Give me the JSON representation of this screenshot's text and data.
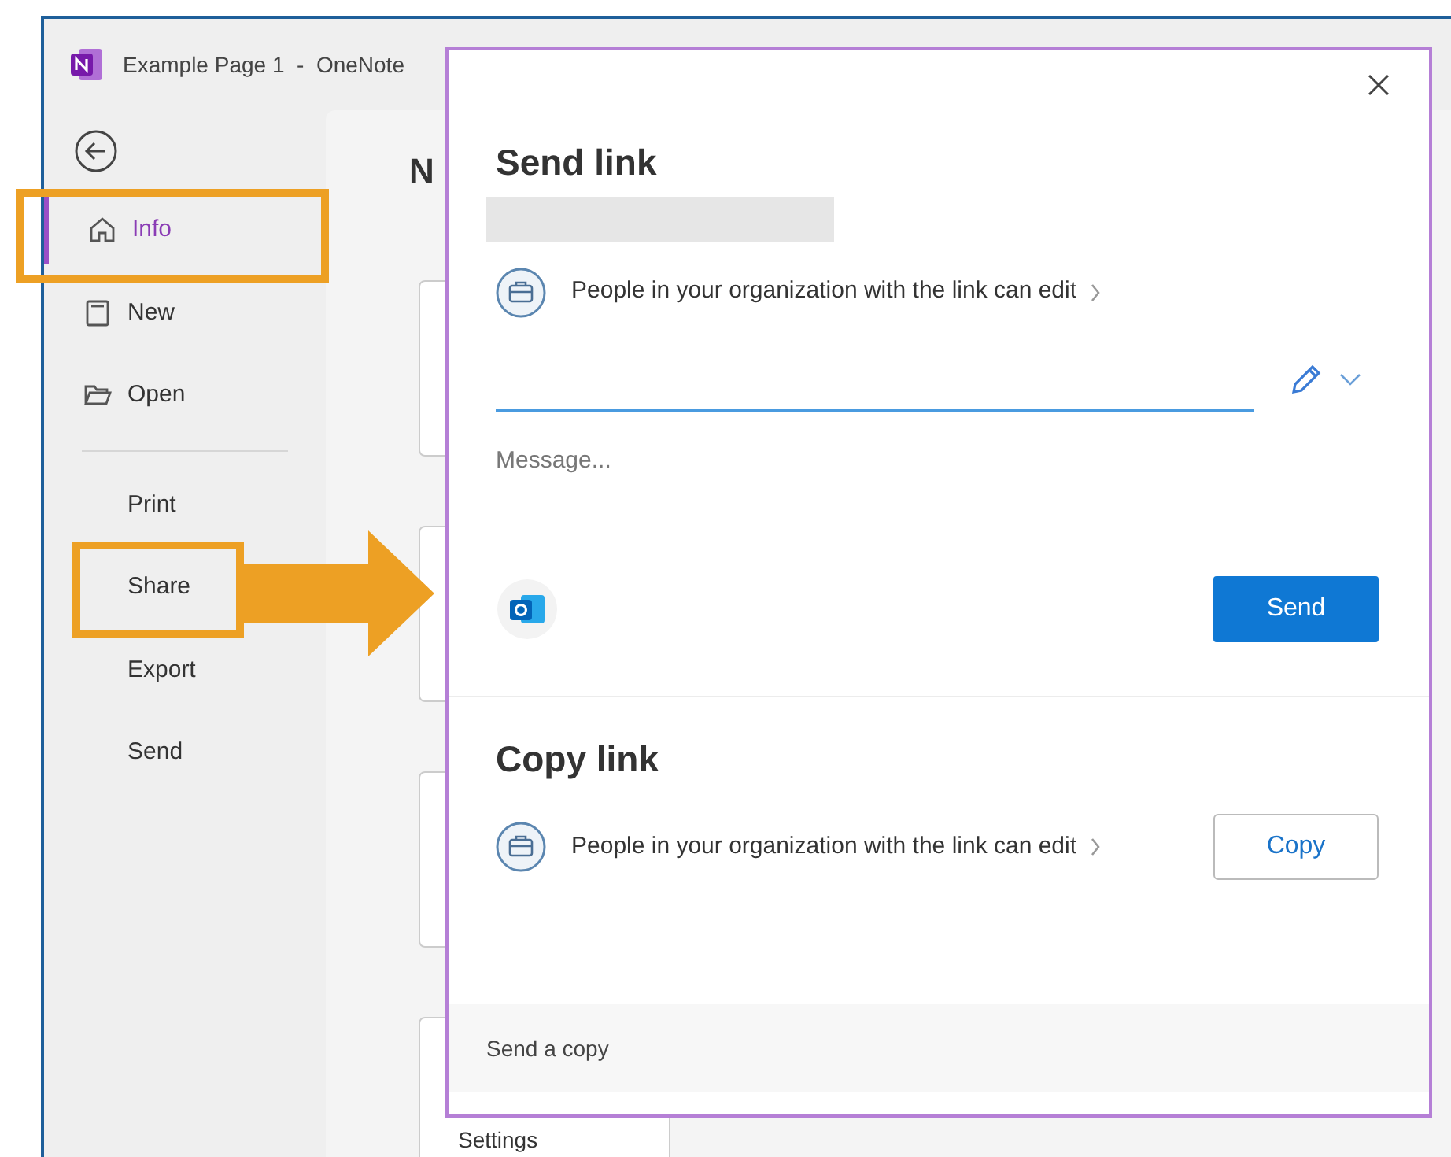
{
  "window": {
    "title": "Example Page 1  -  OneNote"
  },
  "sidebar": {
    "groups": [
      [
        {
          "label": "Info",
          "kind": "home",
          "selected": true,
          "highlighted": true,
          "arrow": false
        },
        {
          "label": "New",
          "kind": "page",
          "selected": false,
          "highlighted": false,
          "arrow": false
        },
        {
          "label": "Open",
          "kind": "folder",
          "selected": false,
          "highlighted": false,
          "arrow": false
        }
      ],
      [
        {
          "label": "Print",
          "kind": "plain",
          "selected": false,
          "highlighted": false,
          "arrow": false
        },
        {
          "label": "Share",
          "kind": "plain",
          "selected": false,
          "highlighted": true,
          "arrow": true
        },
        {
          "label": "Export",
          "kind": "plain",
          "selected": false,
          "highlighted": false,
          "arrow": false
        },
        {
          "label": "Send",
          "kind": "plain",
          "selected": false,
          "highlighted": false,
          "arrow": false
        }
      ]
    ]
  },
  "background": {
    "heading": "N",
    "settings_label": "Settings"
  },
  "dialog": {
    "send_link": {
      "title": "Send link",
      "permission": "People in your organization with the link can edit",
      "message_placeholder": "Message...",
      "button": "Send"
    },
    "copy_link": {
      "title": "Copy link",
      "permission": "People in your organization with the link can edit",
      "button": "Copy"
    },
    "footer": "Send a copy"
  }
}
